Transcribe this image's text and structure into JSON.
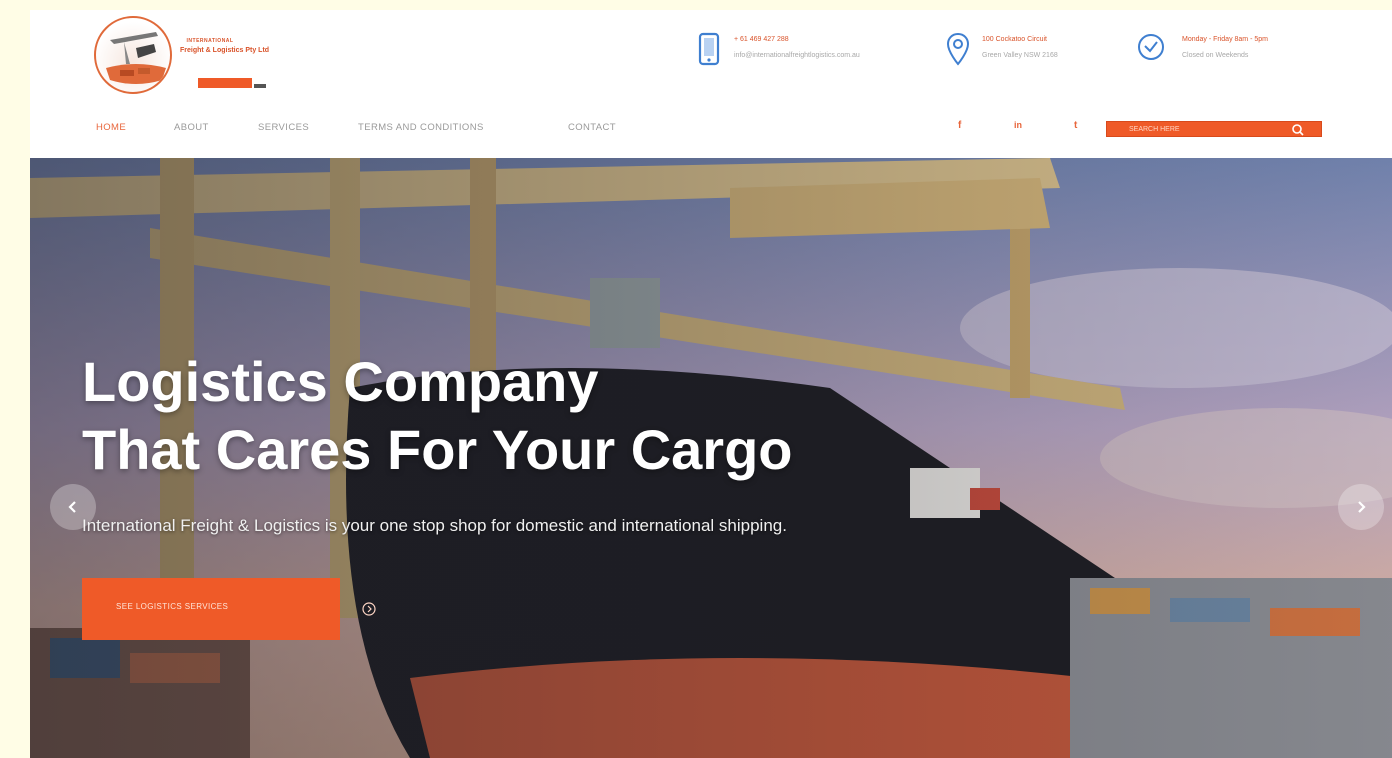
{
  "brand": {
    "kicker": "INTERNATIONAL",
    "name": "Freight & Logistics Pty Ltd"
  },
  "contact": {
    "phone": "+ 61 469 427 288",
    "email": "info@internationalfreightlogistics.com.au",
    "address_line1": "100 Cockatoo Circuit",
    "address_line2": "Green Valley NSW 2168",
    "hours_line1": "Monday - Friday 8am - 5pm",
    "hours_line2": "Closed on Weekends"
  },
  "nav": {
    "items": [
      "HOME",
      "ABOUT",
      "SERVICES",
      "TERMS AND CONDITIONS",
      "CONTACT"
    ],
    "active": "HOME"
  },
  "social": {
    "facebook": "f",
    "linkedin": "in",
    "twitter": "t"
  },
  "search": {
    "placeholder": "SEARCH HERE"
  },
  "hero": {
    "title_line1": "Logistics Company",
    "title_line2": "That Cares For Your Cargo",
    "subtitle": "International Freight & Logistics is your one stop shop for domestic and international shipping.",
    "cta_label": "SEE LOGISTICS SERVICES"
  },
  "colors": {
    "accent": "#ef5a28",
    "nav_text": "#9a9a9a",
    "info_muted": "#a8a8a8"
  },
  "icons": {
    "phone": "phone-icon",
    "location": "map-pin-icon",
    "hours": "clock-icon",
    "search": "search-icon",
    "prev": "chevron-left-icon",
    "next": "chevron-right-icon"
  }
}
